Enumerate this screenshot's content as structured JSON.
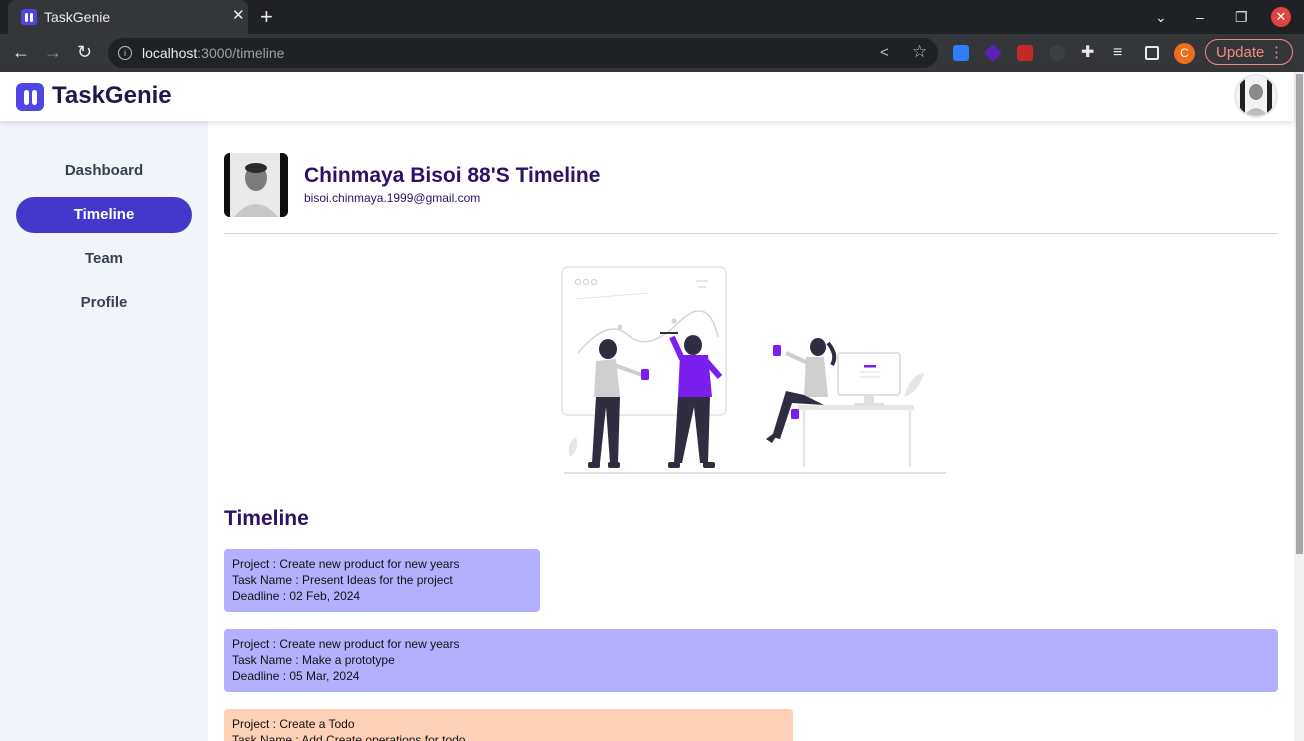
{
  "browser": {
    "tab_title": "TaskGenie",
    "tab_close": "✕",
    "new_tab": "+",
    "url_host": "localhost",
    "url_path": ":3000/timeline",
    "profile_initial": "C",
    "update_label": "Update",
    "icons": [
      "back-arrow",
      "forward-arrow",
      "reload",
      "info",
      "share",
      "star",
      "extensions",
      "reading-list",
      "side-panel",
      "menu-dots"
    ]
  },
  "app": {
    "logo_text": "TaskGenie",
    "brand_color": "#4f46e5"
  },
  "sidebar": {
    "items": [
      {
        "label": "Dashboard",
        "active": false
      },
      {
        "label": "Timeline",
        "active": true
      },
      {
        "label": "Team",
        "active": false
      },
      {
        "label": "Profile",
        "active": false
      }
    ]
  },
  "profile": {
    "name": "Chinmaya Bisoi 88'S Timeline",
    "email": "bisoi.chinmaya.1999@gmail.com"
  },
  "timeline": {
    "title": "Timeline",
    "cards": [
      {
        "project": "Project : Create new product for new years",
        "task": "Task Name : Present Ideas for the project",
        "deadline": "Deadline : 02 Feb, 2024",
        "color": "#b4b0fd"
      },
      {
        "project": "Project : Create new product for new years",
        "task": "Task Name : Make a prototype",
        "deadline": "Deadline : 05 Mar, 2024",
        "color": "#b4b0fd"
      },
      {
        "project": "Project : Create a Todo",
        "task": "Task Name : Add Create operations for todo",
        "deadline": "",
        "color": "#fed0b5"
      }
    ]
  }
}
